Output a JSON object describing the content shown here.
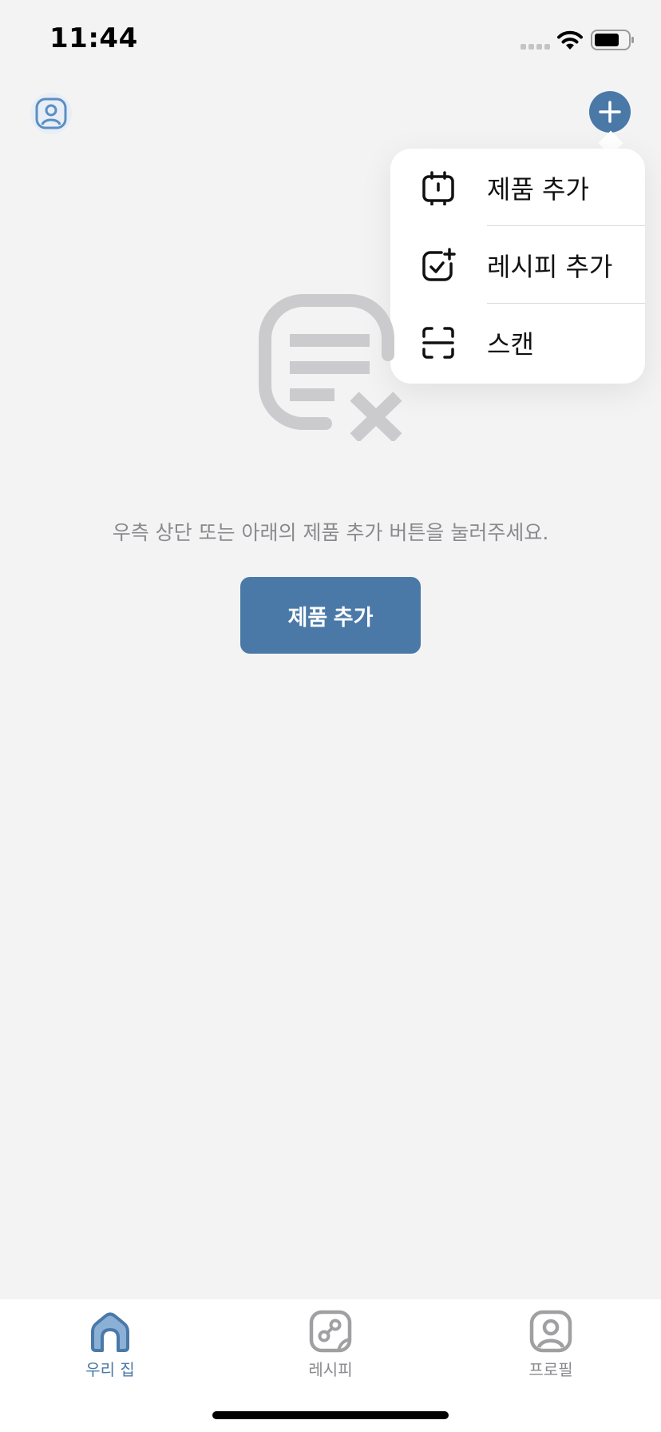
{
  "status_bar": {
    "time": "11:44"
  },
  "header": {
    "profile_icon": "person-icon",
    "add_icon": "plus-icon"
  },
  "dropdown_menu": {
    "items": [
      {
        "label": "제품 추가",
        "icon": "product-icon"
      },
      {
        "label": "레시피 추가",
        "icon": "checkmark-plus-icon"
      },
      {
        "label": "스캔",
        "icon": "scan-frame-icon"
      }
    ]
  },
  "empty_state": {
    "icon": "empty-list-x-icon",
    "message": "우측 상단 또는 아래의 제품 추가 버튼을 눌러주세요.",
    "button_label": "제품 추가"
  },
  "tab_bar": {
    "tabs": [
      {
        "label": "우리 집",
        "icon": "home-icon",
        "active": true
      },
      {
        "label": "레시피",
        "icon": "recipe-icon",
        "active": false
      },
      {
        "label": "프로필",
        "icon": "profile-icon",
        "active": false
      }
    ]
  },
  "colors": {
    "accent": "#4a79a8",
    "background": "#f3f3f4",
    "muted_text": "#8a8a8e",
    "inactive_icon": "#a0a0a3"
  }
}
